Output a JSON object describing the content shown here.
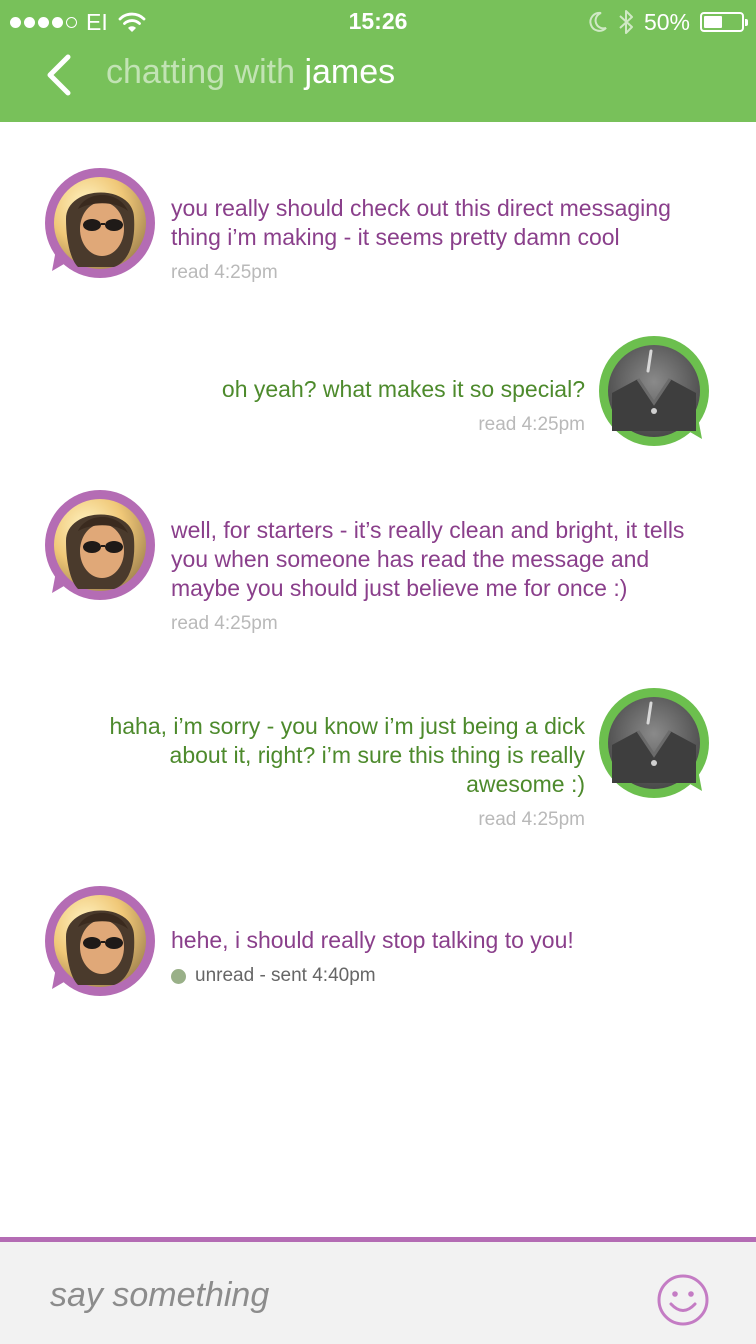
{
  "status_bar": {
    "carrier": "EI",
    "time": "15:26",
    "battery": "50%",
    "battery_level": 0.5,
    "icons": [
      "signal-dots",
      "wifi-icon",
      "moon-icon",
      "bluetooth-icon",
      "battery-icon"
    ]
  },
  "header": {
    "title_prefix": "chatting with",
    "title_name": "james",
    "back_icon": "chevron-left-icon",
    "bg_color": "#78c15a"
  },
  "colors": {
    "incoming_text": "#8a3f8b",
    "outgoing_text": "#4d8a2c",
    "incoming_avatar_ring": "#b46cb4",
    "outgoing_avatar_ring": "#6cbf4e",
    "meta_text": "#b9b9b9",
    "unread_dot": "#99b088"
  },
  "messages": [
    {
      "side": "left",
      "text": "you really should check out this direct messaging thing i’m making - it seems pretty damn cool",
      "meta": "read 4:25pm"
    },
    {
      "side": "right",
      "text": "oh yeah? what makes it so special?",
      "meta": "read 4:25pm"
    },
    {
      "side": "left",
      "text": "well, for starters - it’s really clean and bright, it tells you when someone has read the message and maybe you should just believe me for once :)",
      "meta": "read 4:25pm"
    },
    {
      "side": "right",
      "text": "haha, i’m sorry - you know i’m just being a dick about it, right? i’m sure this thing is really awesome :)",
      "meta": "read 4:25pm"
    },
    {
      "side": "left",
      "text": "hehe, i should really stop talking to you!",
      "meta": "unread - sent 4:40pm",
      "unread": true
    }
  ],
  "composer": {
    "placeholder": "say something",
    "emoji_icon": "smiley-icon"
  }
}
